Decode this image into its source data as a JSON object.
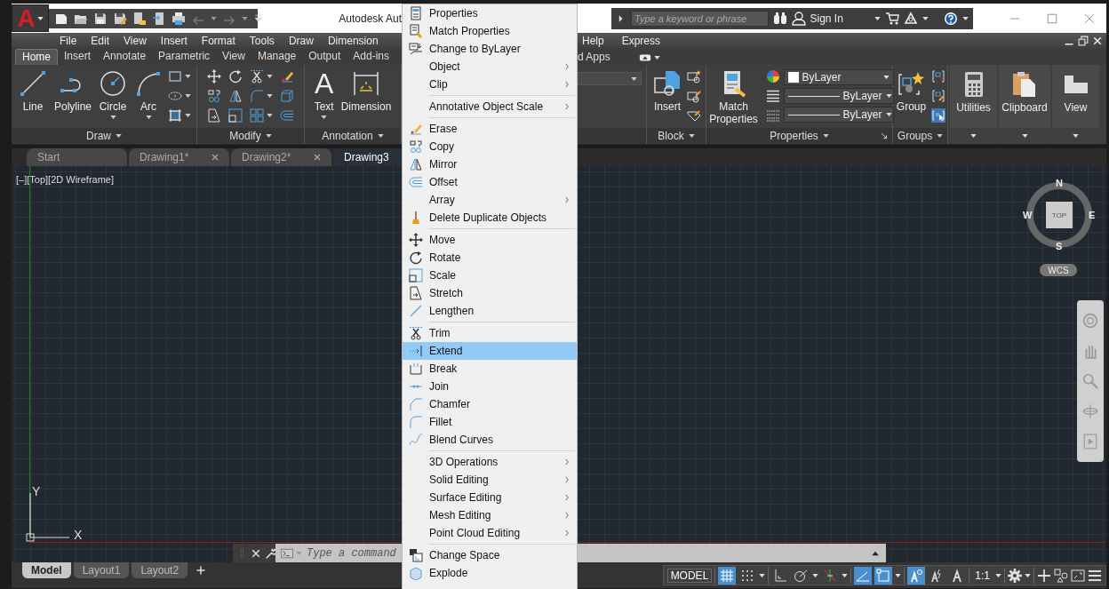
{
  "title_bar": {
    "app_logo": "A",
    "title": "Autodesk Aut",
    "search": {
      "placeholder": "Type a keyword or phrase"
    },
    "sign_in": "Sign In"
  },
  "menu_bar": {
    "left": [
      "File",
      "Edit",
      "View",
      "Insert",
      "Format",
      "Tools",
      "Draw",
      "Dimension"
    ],
    "right": [
      "Help",
      "Express"
    ]
  },
  "ribbon_tabs": {
    "left": [
      {
        "label": "Home",
        "selected": true
      },
      {
        "label": "Insert",
        "selected": false
      },
      {
        "label": "Annotate",
        "selected": false
      },
      {
        "label": "Parametric",
        "selected": false
      },
      {
        "label": "View",
        "selected": false
      },
      {
        "label": "Manage",
        "selected": false
      },
      {
        "label": "Output",
        "selected": false
      },
      {
        "label": "Add-ins",
        "selected": false
      }
    ],
    "right": [
      {
        "label": "d Apps",
        "selected": false
      }
    ]
  },
  "ribbon": {
    "draw": {
      "title": "Draw",
      "tools": [
        {
          "label": "Line",
          "dropdown": false
        },
        {
          "label": "Polyline",
          "dropdown": false
        },
        {
          "label": "Circle",
          "dropdown": true
        },
        {
          "label": "Arc",
          "dropdown": true
        }
      ]
    },
    "modify": {
      "title": "Modify"
    },
    "annotation": {
      "title": "Annotation",
      "text_glyph": "A",
      "tools": [
        {
          "label": "Text",
          "dropdown": true
        },
        {
          "label": "Dimension",
          "dropdown": false
        }
      ]
    },
    "block": {
      "title": "Block",
      "tool": "Insert"
    },
    "properties": {
      "title": "Properties",
      "tool": "Match Properties",
      "dropdowns": [
        "ByLayer",
        "ByLayer",
        "ByLayer"
      ]
    },
    "groups": {
      "title": "Groups",
      "tool": "Group"
    },
    "collapsed": [
      "Utilities",
      "Clipboard",
      "View"
    ]
  },
  "doc_tabs": [
    {
      "label": "Start",
      "selected": false,
      "closable": false
    },
    {
      "label": "Drawing1*",
      "selected": false,
      "closable": true
    },
    {
      "label": "Drawing2*",
      "selected": false,
      "closable": true
    },
    {
      "label": "Drawing3",
      "selected": true,
      "closable": false
    }
  ],
  "viewport": {
    "controls": "[–][Top][2D Wireframe]",
    "compass": {
      "north": "N",
      "west": "W",
      "east": "E",
      "south": "S"
    },
    "view_cube_face": "TOP",
    "ucs_menu": "WCS",
    "axis_labels": {
      "y": "Y",
      "x": "X"
    }
  },
  "command_line": {
    "placeholder": "Type a command"
  },
  "layout_tabs": [
    {
      "label": "Model",
      "selected": true
    },
    {
      "label": "Layout1",
      "selected": false
    },
    {
      "label": "Layout2",
      "selected": false
    }
  ],
  "status_bar": {
    "space": "MODEL",
    "toggles": [
      {
        "on": true
      },
      {
        "on": false
      },
      {
        "on": false
      },
      {
        "on": false
      },
      {
        "on": false
      },
      {
        "on": true
      },
      {
        "on": true
      },
      {
        "on": true
      },
      {
        "on": false
      },
      {
        "on": false
      }
    ],
    "annotation_scale": "1:1"
  },
  "context_menu": {
    "groups": [
      [
        {
          "label": "Properties",
          "submenu": false,
          "selected": false
        },
        {
          "label": "Match Properties",
          "submenu": false,
          "selected": false
        },
        {
          "label": "Change to ByLayer",
          "submenu": false,
          "selected": false
        },
        {
          "label": "Object",
          "submenu": true,
          "selected": false
        },
        {
          "label": "Clip",
          "submenu": true,
          "selected": false
        }
      ],
      [
        {
          "label": "Annotative Object Scale",
          "submenu": true,
          "selected": false
        }
      ],
      [
        {
          "label": "Erase",
          "submenu": false,
          "selected": false
        },
        {
          "label": "Copy",
          "submenu": false,
          "selected": false
        },
        {
          "label": "Mirror",
          "submenu": false,
          "selected": false
        },
        {
          "label": "Offset",
          "submenu": false,
          "selected": false
        },
        {
          "label": "Array",
          "submenu": true,
          "selected": false
        },
        {
          "label": "Delete Duplicate Objects",
          "submenu": false,
          "selected": false
        }
      ],
      [
        {
          "label": "Move",
          "submenu": false,
          "selected": false
        },
        {
          "label": "Rotate",
          "submenu": false,
          "selected": false
        },
        {
          "label": "Scale",
          "submenu": false,
          "selected": false
        },
        {
          "label": "Stretch",
          "submenu": false,
          "selected": false
        },
        {
          "label": "Lengthen",
          "submenu": false,
          "selected": false
        }
      ],
      [
        {
          "label": "Trim",
          "submenu": false,
          "selected": false
        },
        {
          "label": "Extend",
          "submenu": false,
          "selected": true
        },
        {
          "label": "Break",
          "submenu": false,
          "selected": false
        },
        {
          "label": "Join",
          "submenu": false,
          "selected": false
        },
        {
          "label": "Chamfer",
          "submenu": false,
          "selected": false
        },
        {
          "label": "Fillet",
          "submenu": false,
          "selected": false
        },
        {
          "label": "Blend Curves",
          "submenu": false,
          "selected": false
        }
      ],
      [
        {
          "label": "3D Operations",
          "submenu": true,
          "selected": false
        },
        {
          "label": "Solid Editing",
          "submenu": true,
          "selected": false
        },
        {
          "label": "Surface Editing",
          "submenu": true,
          "selected": false
        },
        {
          "label": "Mesh Editing",
          "submenu": true,
          "selected": false
        },
        {
          "label": "Point Cloud Editing",
          "submenu": true,
          "selected": false
        }
      ],
      [
        {
          "label": "Change Space",
          "submenu": false,
          "selected": false
        },
        {
          "label": "Explode",
          "submenu": false,
          "selected": false
        }
      ]
    ]
  }
}
